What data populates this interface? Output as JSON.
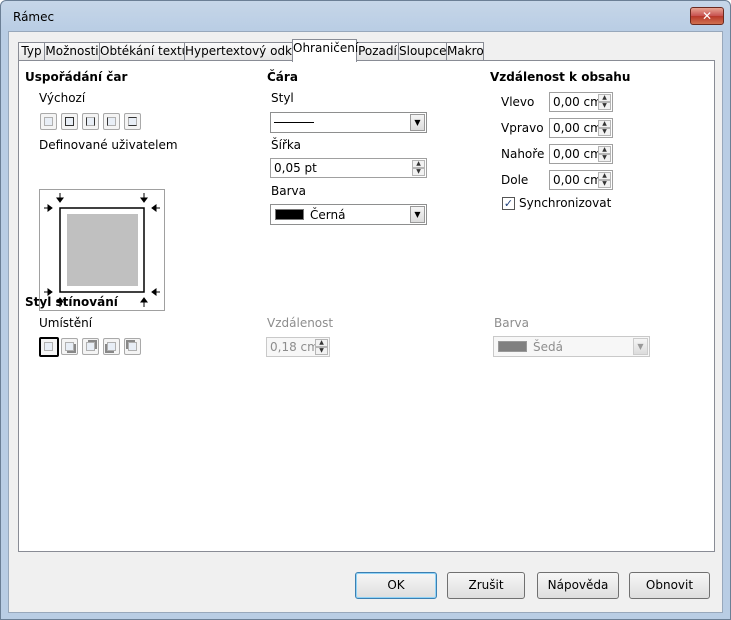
{
  "window": {
    "title": "Rámec",
    "close_glyph": "✕"
  },
  "tabs": [
    {
      "label": "Typ"
    },
    {
      "label": "Možnosti"
    },
    {
      "label": "Obtékání textu"
    },
    {
      "label": "Hypertextový odkaz"
    },
    {
      "label": "Ohraničení",
      "active": true
    },
    {
      "label": "Pozadí"
    },
    {
      "label": "Sloupce"
    },
    {
      "label": "Makro"
    }
  ],
  "line_arrangement": {
    "title": "Uspořádání čar",
    "default_label": "Výchozí",
    "user_defined_label": "Definované uživatelem"
  },
  "line": {
    "title": "Čára",
    "style_label": "Styl",
    "width_label": "Šířka",
    "width_value": "0,05 pt",
    "color_label": "Barva",
    "color_value": "Černá",
    "color_hex": "#000000"
  },
  "spacing": {
    "title": "Vzdálenost k obsahu",
    "left_label": "Vlevo",
    "left_value": "0,00 cm",
    "right_label": "Vpravo",
    "right_value": "0,00 cm",
    "top_label": "Nahoře",
    "top_value": "0,00 cm",
    "bottom_label": "Dole",
    "bottom_value": "0,00 cm",
    "sync_label": "Synchronizovat",
    "sync_checked": true
  },
  "shadow": {
    "title": "Styl stínování",
    "position_label": "Umístění",
    "distance_label": "Vzdálenost",
    "distance_value": "0,18 cm",
    "color_label": "Barva",
    "color_value": "Šedá",
    "color_hex": "#808080"
  },
  "buttons": {
    "ok": "OK",
    "cancel": "Zrušit",
    "help": "Nápověda",
    "reset": "Obnovit"
  }
}
